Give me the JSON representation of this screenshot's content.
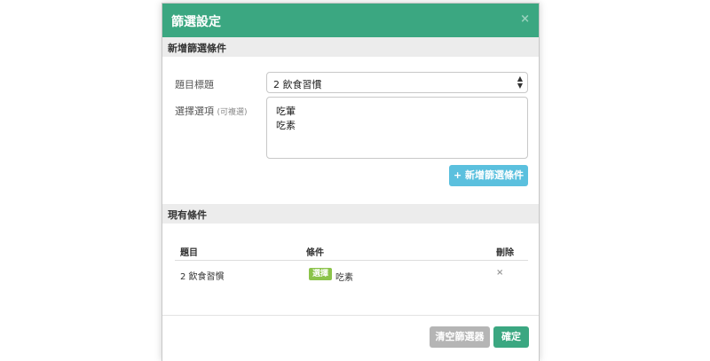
{
  "modal": {
    "title": "篩選設定",
    "close_label": "×"
  },
  "add_section": {
    "title": "新增篩選條件",
    "question_label": "題目標題",
    "question_value": "2 飲食習慣",
    "options_label": "選擇選項",
    "options_hint": "(可複選)",
    "options_lines": [
      "吃葷",
      "吃素"
    ],
    "add_button": "+ 新增篩選條件"
  },
  "existing_section": {
    "title": "現有條件",
    "columns": [
      "題目",
      "條件",
      "刪除"
    ],
    "rows": [
      {
        "question": "2 飲食習慣",
        "badge": "選擇",
        "value": "吃素",
        "delete": "×"
      }
    ]
  },
  "footer": {
    "clear_button": "清空篩選器",
    "ok_button": "確定"
  },
  "colors": {
    "header_green": "#3ba781",
    "add_button_blue": "#5bc0de",
    "badge_green": "#8bc34a",
    "clear_gray": "#b5b5b5"
  }
}
